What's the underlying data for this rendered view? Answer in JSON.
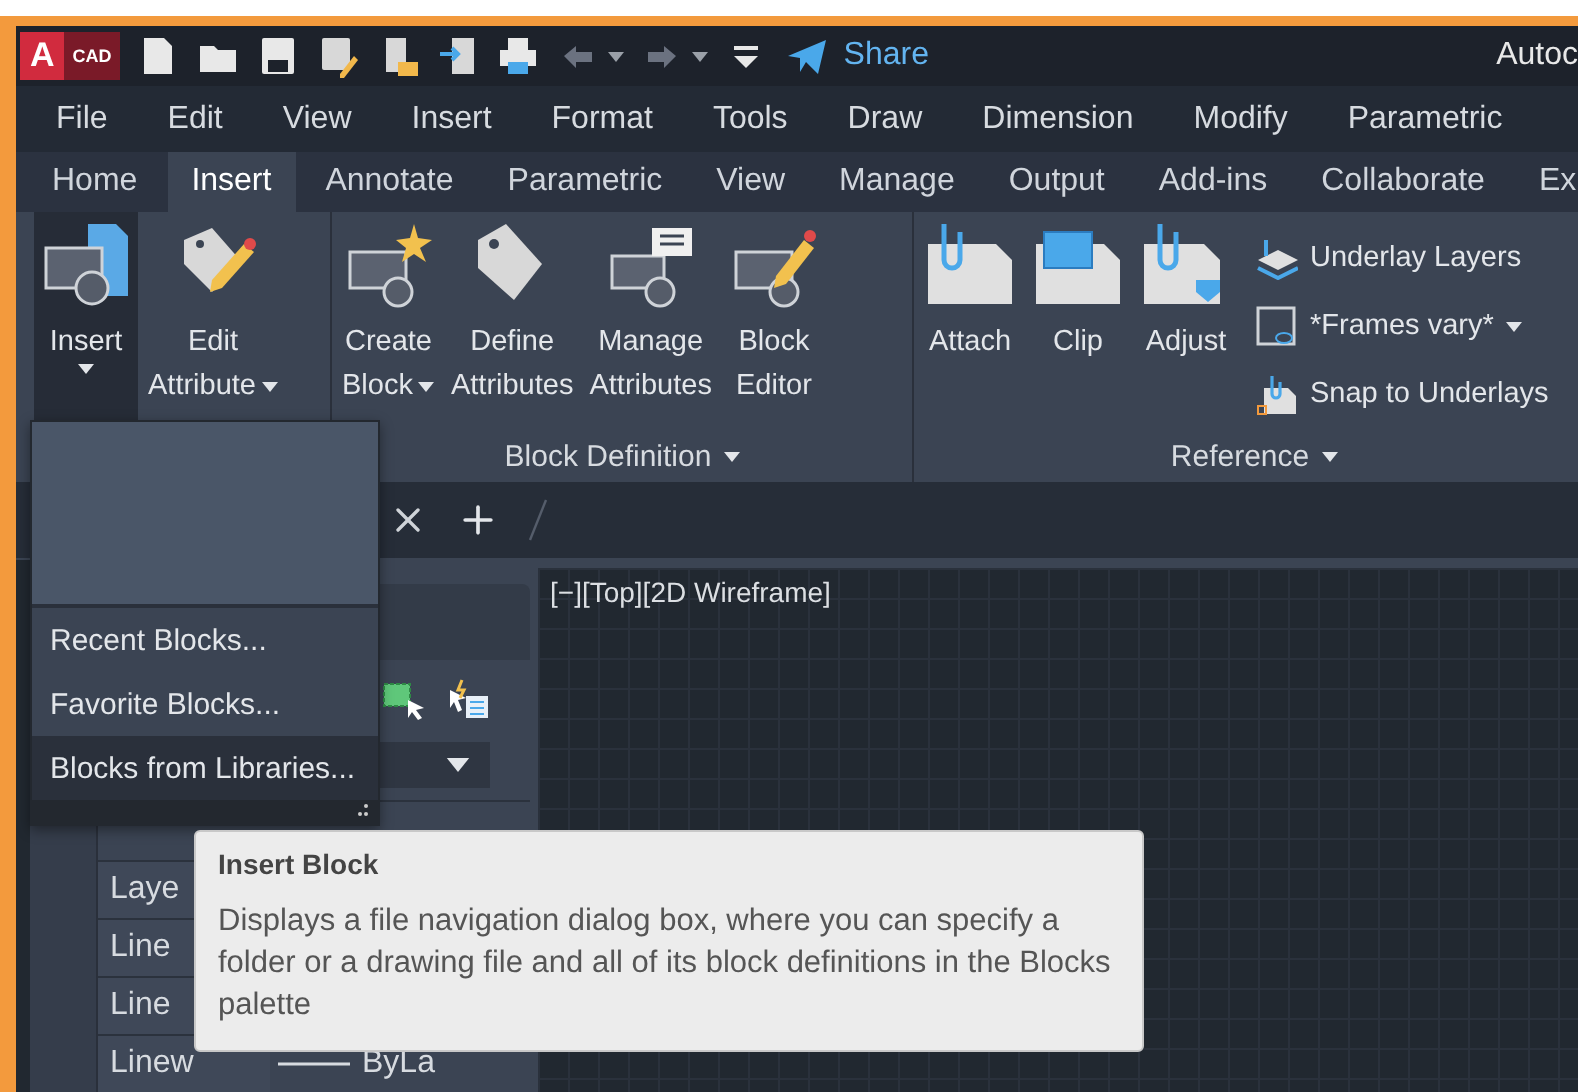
{
  "title_bar": {
    "logo_letter": "A",
    "logo_text": "CAD",
    "share": "Share",
    "title": "Autoc"
  },
  "menu": [
    "File",
    "Edit",
    "View",
    "Insert",
    "Format",
    "Tools",
    "Draw",
    "Dimension",
    "Modify",
    "Parametric"
  ],
  "ribbon_tabs": [
    {
      "label": "Home",
      "selected": false
    },
    {
      "label": "Insert",
      "selected": true
    },
    {
      "label": "Annotate",
      "selected": false
    },
    {
      "label": "Parametric",
      "selected": false
    },
    {
      "label": "View",
      "selected": false
    },
    {
      "label": "Manage",
      "selected": false
    },
    {
      "label": "Output",
      "selected": false
    },
    {
      "label": "Add-ins",
      "selected": false
    },
    {
      "label": "Collaborate",
      "selected": false
    },
    {
      "label": "Ex",
      "selected": false
    }
  ],
  "ribbon_panels": [
    {
      "buttons": [
        {
          "lines": [
            "Insert"
          ],
          "dropdown": true,
          "pressed": true
        },
        {
          "lines": [
            "Edit",
            "Attribute"
          ],
          "dropdown": true,
          "pressed": false
        }
      ]
    },
    {
      "title": "Block Definition",
      "buttons": [
        {
          "lines": [
            "Create",
            "Block"
          ],
          "dropdown": true,
          "pressed": false
        },
        {
          "lines": [
            "Define",
            "Attributes"
          ],
          "dropdown": false,
          "pressed": false
        },
        {
          "lines": [
            "Manage",
            "Attributes"
          ],
          "dropdown": false,
          "pressed": false
        },
        {
          "lines": [
            "Block",
            "Editor"
          ],
          "dropdown": false,
          "pressed": false
        }
      ]
    },
    {
      "title": "Reference",
      "buttons": [
        {
          "lines": [
            "Attach"
          ],
          "dropdown": false,
          "pressed": false
        },
        {
          "lines": [
            "Clip"
          ],
          "dropdown": false,
          "pressed": false
        },
        {
          "lines": [
            "Adjust"
          ],
          "dropdown": false,
          "pressed": false
        }
      ],
      "small_buttons": [
        {
          "label": "Underlay Layers",
          "dropdown": false
        },
        {
          "label": "*Frames vary*",
          "dropdown": true
        },
        {
          "label": "Snap to Underlays",
          "dropdown": false
        }
      ]
    }
  ],
  "viewport": {
    "label": "[−][Top][2D Wireframe]"
  },
  "properties": {
    "rows": [
      {
        "label": "Laye"
      },
      {
        "label": "Line"
      },
      {
        "label": "Line"
      },
      {
        "label": "Linew",
        "value": "ByLa"
      }
    ]
  },
  "insert_dropdown": {
    "items": [
      {
        "label": "Recent Blocks...",
        "selected": false
      },
      {
        "label": "Favorite Blocks...",
        "selected": false
      },
      {
        "label": "Blocks from Libraries...",
        "selected": true
      }
    ]
  },
  "tooltip": {
    "title": "Insert Block",
    "body": "Displays a file navigation dialog box, where you can specify a folder or a drawing file and all of its block definitions in the Blocks palette"
  }
}
